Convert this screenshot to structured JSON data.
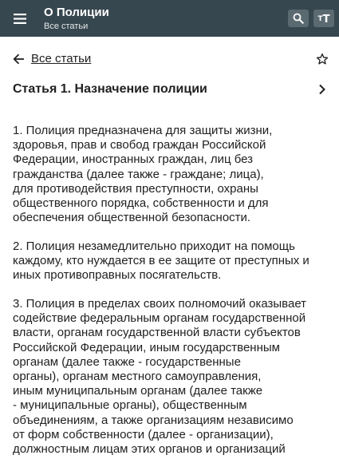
{
  "appbar": {
    "title": "О Полиции",
    "subtitle": "Все статьи",
    "menu_icon": "menu-icon",
    "search_icon": "search-icon",
    "font_size_icon": "font-size-icon",
    "font_glyph_large": "T",
    "font_glyph_small": "T",
    "background_color": "#37474f"
  },
  "nav": {
    "back_link_label": "Все статьи",
    "back_icon": "arrow-left-icon",
    "favorite_icon": "star-outline-icon"
  },
  "article": {
    "title": "Статья 1. Назначение полиции",
    "next_icon": "chevron-right-icon",
    "paragraphs": [
      [
        "1. Полиция предназначена для защиты жизни,",
        "здоровья, прав и свобод граждан Российской",
        "Федерации, иностранных граждан, лиц без",
        "гражданства (далее также - граждане; лица),",
        "для противодействия преступности, охраны",
        "общественного порядка, собственности и для",
        "обеспечения общественной безопасности."
      ],
      [
        "2. Полиция незамедлительно приходит на помощь",
        "каждому, кто нуждается в ее защите от преступных и",
        "иных противоправных посягательств."
      ],
      [
        "3. Полиция в пределах своих полномочий оказывает",
        "содействие федеральным органам государственной",
        "власти, органам государственной власти субъектов",
        "Российской Федерации, иным государственным",
        "органам (далее также - государственные",
        "органы), органам местного самоуправления,",
        "иным муниципальным органам (далее также",
        "- муниципальные органы), общественным",
        "объединениям, а также организациям независимо",
        "от форм собственности (далее - организации),",
        "должностным лицам этих органов и организаций"
      ]
    ]
  }
}
